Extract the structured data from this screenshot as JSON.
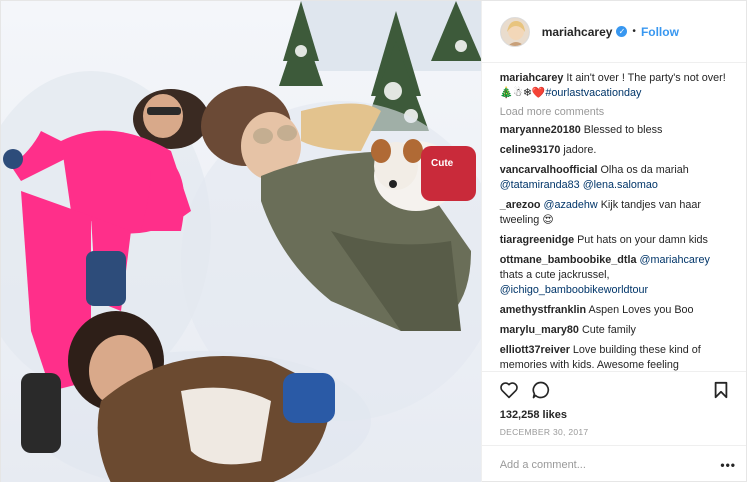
{
  "post": {
    "username": "mariahcarey",
    "verified_icon": "verified-badge-icon",
    "separator": "•",
    "follow_label": "Follow",
    "caption": {
      "username": "mariahcarey",
      "text": "It ain't over ! The party's not over!",
      "emoji": "🎄☃❄❤️",
      "hashtag": "#ourlastvacationday"
    },
    "load_more_label": "Load more comments",
    "comments": [
      {
        "username": "maryanne20180",
        "text": "Blessed to bless"
      },
      {
        "username": "celine93170",
        "text": "jadore."
      },
      {
        "username": "vancarvalhoofficial",
        "text": "Olha os da mariah",
        "mentions": "@tatamiranda83 @lena.salomao"
      },
      {
        "username": "_arezoo",
        "mention_prefix": "@azadehw",
        "text": "Kijk tandjes van haar tweeling 😍"
      },
      {
        "username": "tiaragreenidge",
        "text": "Put hats on your damn kids"
      },
      {
        "username": "ottmane_bamboobike_dtla",
        "mention_prefix": "@mariahcarey",
        "text": "thats a cute jackrussel,",
        "mentions": "@ichigo_bamboobikeworldtour"
      },
      {
        "username": "amethystfranklin",
        "text": "Aspen Loves you Boo"
      },
      {
        "username": "marylu_mary80",
        "text": "Cute family"
      },
      {
        "username": "elliott37reiver",
        "text": "Love building these kind of memories with kids. Awesome feeling"
      }
    ],
    "likes": "132,258 likes",
    "date": "DECEMBER 30, 2017",
    "add_comment_placeholder": "Add a comment...",
    "more_label": "•••",
    "icons": {
      "like": "heart-icon",
      "comment": "comment-bubble-icon",
      "save": "bookmark-icon"
    }
  }
}
